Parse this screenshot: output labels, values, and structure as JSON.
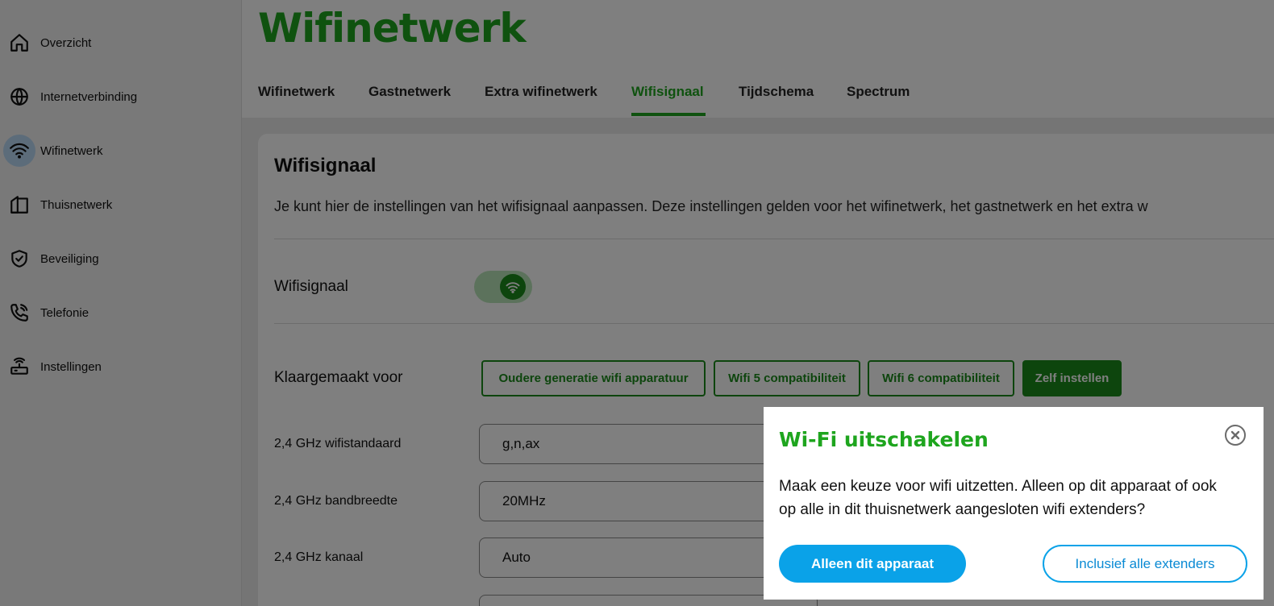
{
  "sidebar": {
    "items": [
      {
        "label": "Overzicht",
        "icon": "home-icon"
      },
      {
        "label": "Internetverbinding",
        "icon": "globe-icon"
      },
      {
        "label": "Wifinetwerk",
        "icon": "wifi-icon",
        "active": true
      },
      {
        "label": "Thuisnetwerk",
        "icon": "door-icon"
      },
      {
        "label": "Beveiliging",
        "icon": "shield-check-icon"
      },
      {
        "label": "Telefonie",
        "icon": "phone-icon"
      },
      {
        "label": "Instellingen",
        "icon": "router-icon"
      }
    ]
  },
  "header": {
    "title": "Wifinetwerk",
    "tabs": [
      {
        "label": "Wifinetwerk"
      },
      {
        "label": "Gastnetwerk"
      },
      {
        "label": "Extra wifinetwerk"
      },
      {
        "label": "Wifisignaal",
        "active": true
      },
      {
        "label": "Tijdschema"
      },
      {
        "label": "Spectrum"
      }
    ]
  },
  "card": {
    "title": "Wifisignaal",
    "description": "Je kunt hier de instellingen van het wifisignaal aanpassen. Deze instellingen gelden voor het wifinetwerk, het gastnetwerk en het extra w",
    "wifi_toggle_label": "Wifisignaal",
    "wifi_toggle_on": true,
    "preset_label": "Klaargemaakt voor",
    "presets": [
      {
        "label": "Oudere generatie wifi apparatuur"
      },
      {
        "label": "Wifi 5 compatibiliteit"
      },
      {
        "label": "Wifi 6 compatibiliteit"
      },
      {
        "label": "Zelf instellen",
        "selected": true
      }
    ],
    "fields": [
      {
        "label": "2,4 GHz wifistandaard",
        "value": "g,n,ax"
      },
      {
        "label": "2,4 GHz bandbreedte",
        "value": "20MHz"
      },
      {
        "label": "2,4 GHz kanaal",
        "value": "Auto"
      }
    ]
  },
  "dialog": {
    "title": "Wi-Fi uitschakelen",
    "message": "Maak een keuze voor wifi uitzetten. Alleen op dit apparaat of ook op alle in dit thuisnetwerk aangesloten wifi extenders?",
    "primary_label": "Alleen dit apparaat",
    "secondary_label": "Inclusief alle extenders"
  },
  "colors": {
    "brand_green": "#1ea51e",
    "button_green": "#1a8a1a",
    "dialog_blue": "#0aa2e8",
    "overlay": "rgba(0,0,0,0.5)"
  }
}
